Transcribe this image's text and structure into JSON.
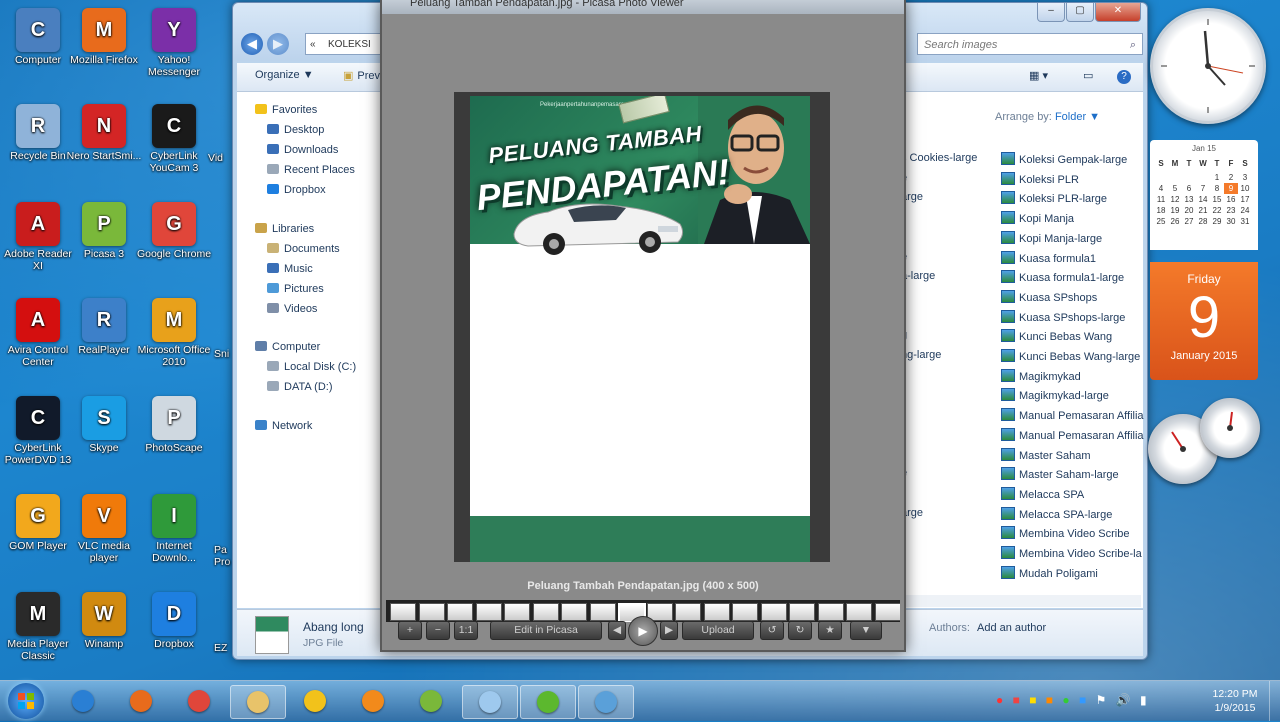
{
  "desktop_icons": [
    {
      "label": "Computer",
      "icon": "computer-icon",
      "color": "#4a7fbf"
    },
    {
      "label": "Mozilla Firefox",
      "icon": "firefox-icon",
      "color": "#e86b1c"
    },
    {
      "label": "Yahoo! Messenger",
      "icon": "yahoo-messenger-icon",
      "color": "#7b2fa8"
    },
    {
      "label": "Recycle Bin",
      "icon": "recycle-bin-icon",
      "color": "#8fb3d9"
    },
    {
      "label": "Nero StartSmi...",
      "icon": "nero-icon",
      "color": "#d42525"
    },
    {
      "label": "CyberLink YouCam 3",
      "icon": "youcam-icon",
      "color": "#1a1a1a"
    },
    {
      "label": "Adobe Reader XI",
      "icon": "adobe-reader-icon",
      "color": "#c91d1d"
    },
    {
      "label": "Picasa 3",
      "icon": "picasa-icon",
      "color": "#7ab83a"
    },
    {
      "label": "Google Chrome",
      "icon": "chrome-icon",
      "color": "#e0463a"
    },
    {
      "label": "Avira Control Center",
      "icon": "avira-icon",
      "color": "#d40f0f"
    },
    {
      "label": "RealPlayer",
      "icon": "realplayer-icon",
      "color": "#3d80c9"
    },
    {
      "label": "Microsoft Office 2010",
      "icon": "office-icon",
      "color": "#e8a11b"
    },
    {
      "label": "CyberLink PowerDVD 13",
      "icon": "powerdvd-icon",
      "color": "#111a2a"
    },
    {
      "label": "Skype",
      "icon": "skype-icon",
      "color": "#1a9de3"
    },
    {
      "label": "PhotoScape",
      "icon": "photoscape-icon",
      "color": "#cfd8e0"
    },
    {
      "label": "GOM Player",
      "icon": "gom-player-icon",
      "color": "#f2a81c"
    },
    {
      "label": "VLC media player",
      "icon": "vlc-icon",
      "color": "#f07a0a"
    },
    {
      "label": "Internet Downlo...",
      "icon": "idm-icon",
      "color": "#2f9a3a"
    },
    {
      "label": "Media Player Classic",
      "icon": "media-player-classic-icon",
      "color": "#2a2a2a"
    },
    {
      "label": "Winamp",
      "icon": "winamp-icon",
      "color": "#d18a10"
    },
    {
      "label": "Dropbox",
      "icon": "dropbox-icon",
      "color": "#1e7fe0"
    }
  ],
  "desktop_partial_labels": [
    "Vid",
    "Sni",
    "Pa Pro",
    "EZ"
  ],
  "explorer": {
    "address": "KOLEKSI",
    "search_placeholder": "Search images",
    "toolbar": {
      "organize": "Organize ▼",
      "preview": "Prev",
      "arrange_label": "Arrange by:",
      "arrange_value": "Folder ▼"
    },
    "nav": {
      "favorites": "Favorites",
      "favorites_items": [
        "Desktop",
        "Downloads",
        "Recent Places",
        "Dropbox"
      ],
      "libraries": "Libraries",
      "libraries_items": [
        "Documents",
        "Music",
        "Pictures",
        "Videos"
      ],
      "computer": "Computer",
      "computer_items": [
        "Local Disk (C:)",
        "DATA (D:)"
      ],
      "network": "Network"
    },
    "left_column_partials": [
      "s Cookies-large",
      "e",
      "arge",
      "",
      "",
      "e",
      "a-large",
      "",
      "",
      "g",
      "ng-large",
      "",
      "",
      "",
      "",
      "",
      "e",
      "",
      "arge"
    ],
    "files": [
      "Koleksi Gempak-large",
      "Koleksi PLR",
      "Koleksi PLR-large",
      "Kopi Manja",
      "Kopi Manja-large",
      "Kuasa formula1",
      "Kuasa formula1-large",
      "Kuasa SPshops",
      "Kuasa SPshops-large",
      "Kunci Bebas Wang",
      "Kunci Bebas Wang-large",
      "Magikmykad",
      "Magikmykad-large",
      "Manual Pemasaran Affilia",
      "Manual Pemasaran Affilia",
      "Master Saham",
      "Master Saham-large",
      "Melacca SPA",
      "Melacca SPA-large",
      "Membina Video Scribe",
      "Membina Video Scribe-la",
      "Mudah Poligami"
    ],
    "details": {
      "name": "Abang long",
      "type": "JPG File",
      "authors_label": "Authors:",
      "authors_value": "Add an author"
    }
  },
  "viewer": {
    "title": "Peluang Tambah Pendapatan.jpg - Picasa Photo Viewer",
    "banner_small_text": "Pekerjaanpertahunanpemasaran",
    "banner_line1": "PELUANG TAMBAH",
    "banner_line2": "PENDAPATAN!",
    "caption": "Peluang Tambah Pendapatan.jpg (400 x 500)",
    "controls": {
      "zoom_in": "+",
      "zoom_out": "−",
      "actual": "1:1",
      "edit": "Edit in Picasa",
      "play": "▶",
      "upload": "Upload",
      "rotate_left": "↺",
      "rotate_right": "↻",
      "star": "★",
      "menu": "▼"
    }
  },
  "calendar": {
    "month_header": "Jan 15",
    "weekday_letters": [
      "S",
      "M",
      "T",
      "W",
      "T",
      "F",
      "S"
    ],
    "days": [
      "",
      "",
      "",
      "",
      "1",
      "2",
      "3",
      "4",
      "5",
      "6",
      "7",
      "8",
      "9",
      "10",
      "11",
      "12",
      "13",
      "14",
      "15",
      "16",
      "17",
      "18",
      "19",
      "20",
      "21",
      "22",
      "23",
      "24",
      "25",
      "26",
      "27",
      "28",
      "29",
      "30",
      "31"
    ],
    "weekday": "Friday",
    "day": "9",
    "month_year": "January 2015"
  },
  "taskbar": {
    "apps": [
      {
        "icon": "internet-explorer-icon",
        "color": "#2a7fd4"
      },
      {
        "icon": "firefox-icon",
        "color": "#e86b1c"
      },
      {
        "icon": "chrome-icon",
        "color": "#e0463a"
      },
      {
        "icon": "file-explorer-icon",
        "color": "#e8c36a"
      },
      {
        "icon": "youcam-icon",
        "color": "#f2c21b"
      },
      {
        "icon": "media-player-icon",
        "color": "#f28a1b"
      },
      {
        "icon": "picasa-icon",
        "color": "#7ab83a"
      },
      {
        "icon": "notepad-icon",
        "color": "#9ec9ee"
      },
      {
        "icon": "camtasia-icon",
        "color": "#5cb82e"
      },
      {
        "icon": "picasa-photo-viewer-icon",
        "color": "#5aa0d9"
      }
    ],
    "time": "12:20 PM",
    "date": "1/9/2015"
  }
}
